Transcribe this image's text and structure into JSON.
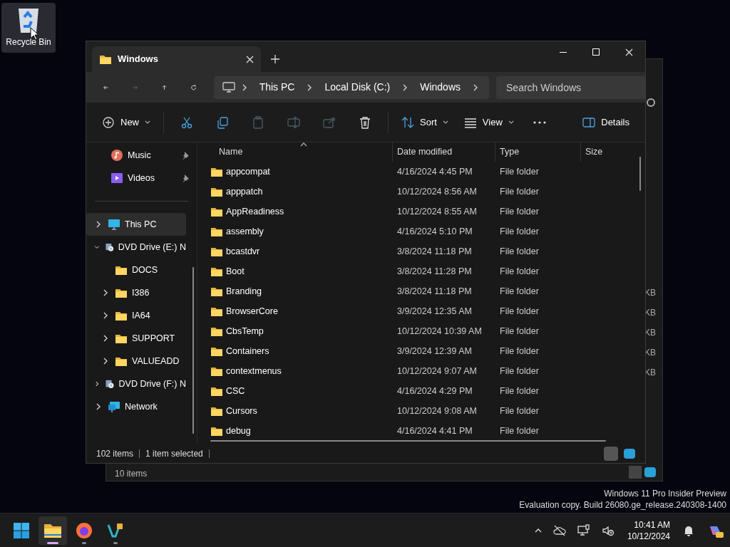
{
  "desktop_icons": [
    {
      "label": "Recycle Bin",
      "selected": true
    }
  ],
  "background_window": {
    "size_fragments": [
      "KB",
      "KB",
      "KB",
      "KB",
      "KB"
    ],
    "status_bar": {
      "item_count": "10 items"
    }
  },
  "window": {
    "tabs": [
      {
        "title": "Windows",
        "selected": true
      }
    ],
    "nav_buttons": [
      {
        "kind": "back",
        "disabled": false
      },
      {
        "kind": "forward",
        "disabled": true
      },
      {
        "kind": "up",
        "disabled": false
      },
      {
        "kind": "refresh",
        "disabled": false
      }
    ],
    "breadcrumb": [
      "This PC",
      "Local Disk (C:)",
      "Windows"
    ],
    "search": {
      "placeholder": "Search Windows"
    },
    "toolbar": [
      {
        "kind": "new",
        "label": "New",
        "disabled": false
      },
      {
        "kind": "cut",
        "disabled": false
      },
      {
        "kind": "copy",
        "disabled": false
      },
      {
        "kind": "paste",
        "disabled": true
      },
      {
        "kind": "rename",
        "disabled": true
      },
      {
        "kind": "share",
        "disabled": true
      },
      {
        "kind": "delete",
        "disabled": false
      },
      {
        "kind": "sort",
        "label": "Sort",
        "disabled": false
      },
      {
        "kind": "view",
        "label": "View",
        "disabled": false
      },
      {
        "kind": "more",
        "disabled": false
      },
      {
        "kind": "details",
        "label": "Details",
        "disabled": false
      }
    ],
    "sidebar": {
      "pinned": [
        {
          "kind": "music",
          "label": "Music"
        },
        {
          "kind": "videos",
          "label": "Videos"
        }
      ],
      "tree": [
        {
          "kind": "pc",
          "label": "This PC",
          "selected": true,
          "expandable": true,
          "expanded": false
        },
        {
          "kind": "dvd",
          "label": "DVD Drive (E:) N",
          "selected": false,
          "expandable": true,
          "expanded": true,
          "children": [
            {
              "kind": "folder",
              "label": "DOCS",
              "selected": false,
              "expandable": false,
              "expanded": false
            },
            {
              "kind": "folder",
              "label": "I386",
              "selected": false,
              "expandable": true,
              "expanded": false
            },
            {
              "kind": "folder",
              "label": "IA64",
              "selected": false,
              "expandable": true,
              "expanded": false
            },
            {
              "kind": "folder",
              "label": "SUPPORT",
              "selected": false,
              "expandable": true,
              "expanded": false
            },
            {
              "kind": "folder",
              "label": "VALUEADD",
              "selected": false,
              "expandable": true,
              "expanded": false
            }
          ]
        },
        {
          "kind": "dvd",
          "label": "DVD Drive (F:) N",
          "selected": false,
          "expandable": true,
          "expanded": false
        },
        {
          "kind": "network",
          "label": "Network",
          "selected": false,
          "expandable": true,
          "expanded": false
        }
      ]
    },
    "table": {
      "columns": [
        "Name",
        "Date modified",
        "Type",
        "Size"
      ],
      "rows": [
        {
          "name": "appcompat",
          "date": "4/16/2024 4:45 PM",
          "type": "File folder"
        },
        {
          "name": "apppatch",
          "date": "10/12/2024 8:56 AM",
          "type": "File folder"
        },
        {
          "name": "AppReadiness",
          "date": "10/12/2024 8:55 AM",
          "type": "File folder"
        },
        {
          "name": "assembly",
          "date": "4/16/2024 5:10 PM",
          "type": "File folder"
        },
        {
          "name": "bcastdvr",
          "date": "3/8/2024 11:18 PM",
          "type": "File folder"
        },
        {
          "name": "Boot",
          "date": "3/8/2024 11:28 PM",
          "type": "File folder"
        },
        {
          "name": "Branding",
          "date": "3/8/2024 11:18 PM",
          "type": "File folder"
        },
        {
          "name": "BrowserCore",
          "date": "3/9/2024 12:35 AM",
          "type": "File folder"
        },
        {
          "name": "CbsTemp",
          "date": "10/12/2024 10:39 AM",
          "type": "File folder"
        },
        {
          "name": "Containers",
          "date": "3/9/2024 12:39 AM",
          "type": "File folder"
        },
        {
          "name": "contextmenus",
          "date": "10/12/2024 9:07 AM",
          "type": "File folder"
        },
        {
          "name": "CSC",
          "date": "4/16/2024 4:29 PM",
          "type": "File folder"
        },
        {
          "name": "Cursors",
          "date": "10/12/2024 9:08 AM",
          "type": "File folder"
        },
        {
          "name": "debug",
          "date": "4/16/2024 4:41 PM",
          "type": "File folder"
        }
      ]
    },
    "status_bar": {
      "item_count": "102 items",
      "selection": "1 item selected"
    }
  },
  "watermark": [
    "Windows 11 Pro Insider Preview",
    "Evaluation copy. Build 26080.ge_release.240308-1400"
  ],
  "taskbar": {
    "apps": [
      {
        "kind": "start",
        "active": false,
        "running": false
      },
      {
        "kind": "explorer",
        "active": true,
        "running": true
      },
      {
        "kind": "browser",
        "active": false,
        "running": true
      },
      {
        "kind": "app",
        "active": false,
        "running": true
      }
    ],
    "clock": {
      "time": "10:41 AM",
      "date": "10/12/2024"
    }
  }
}
